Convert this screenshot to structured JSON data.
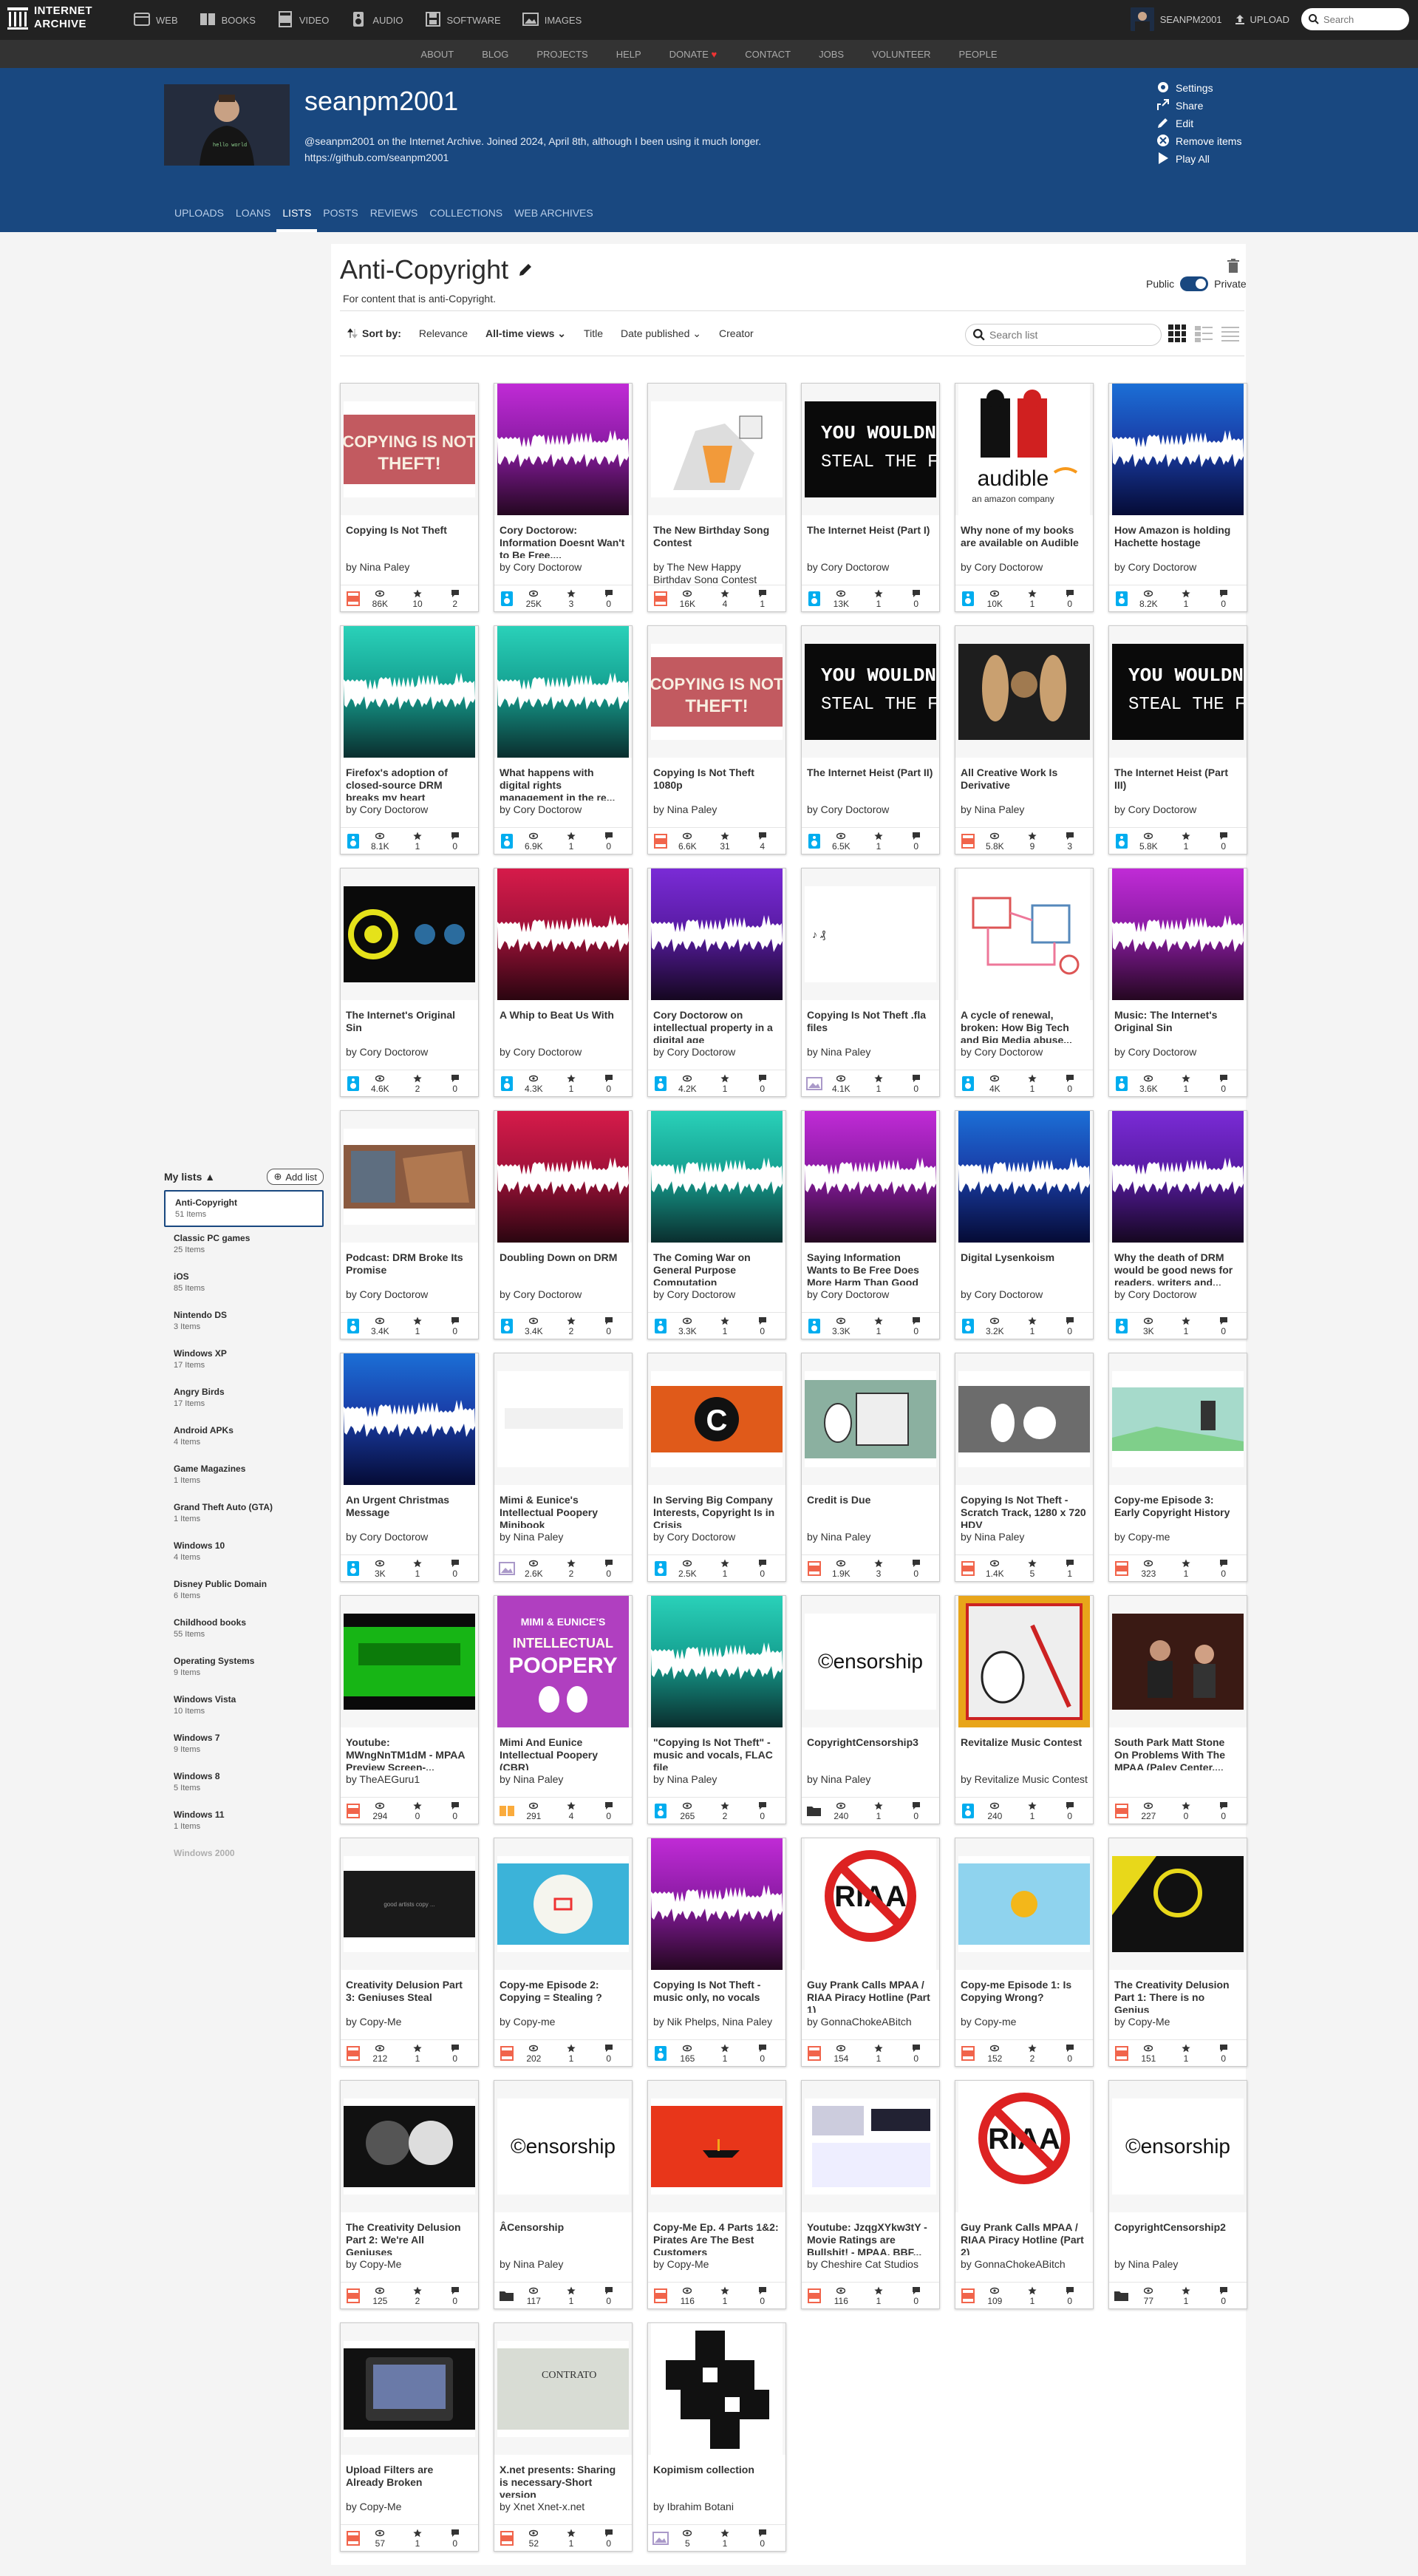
{
  "topnav": {
    "logo": "INTERNET ARCHIVE",
    "items": [
      {
        "label": "WEB",
        "icon": "web-icon"
      },
      {
        "label": "BOOKS",
        "icon": "books-icon"
      },
      {
        "label": "VIDEO",
        "icon": "video-icon"
      },
      {
        "label": "AUDIO",
        "icon": "audio-icon"
      },
      {
        "label": "SOFTWARE",
        "icon": "software-icon"
      },
      {
        "label": "IMAGES",
        "icon": "images-icon"
      }
    ],
    "user": "SEANPM2001",
    "upload": "UPLOAD",
    "search_placeholder": "Search"
  },
  "subnav": [
    "ABOUT",
    "BLOG",
    "PROJECTS",
    "HELP",
    "DONATE",
    "CONTACT",
    "JOBS",
    "VOLUNTEER",
    "PEOPLE"
  ],
  "profile": {
    "username": "seanpm2001",
    "bio_line1": "@seanpm2001 on the Internet Archive. Joined 2024, April 8th, although I been using it much longer.",
    "bio_line2": "https://github.com/seanpm2001"
  },
  "actions": [
    "Settings",
    "Share",
    "Edit",
    "Remove items",
    "Play All"
  ],
  "tabs": [
    "UPLOADS",
    "LOANS",
    "LISTS",
    "POSTS",
    "REVIEWS",
    "COLLECTIONS",
    "WEB ARCHIVES"
  ],
  "list": {
    "title": "Anti-Copyright",
    "description": "For content that is anti-Copyright.",
    "public_label": "Public",
    "private_label": "Private"
  },
  "sort": {
    "label": "Sort by:",
    "options": [
      "Relevance",
      "All-time views",
      "Title",
      "Date published",
      "Creator"
    ],
    "search_placeholder": "Search list"
  },
  "mylists": {
    "title": "My lists",
    "add": "Add list",
    "items": [
      {
        "name": "Anti-Copyright",
        "count": "51 Items"
      },
      {
        "name": "Classic PC games",
        "count": "25 Items"
      },
      {
        "name": "iOS",
        "count": "85 Items"
      },
      {
        "name": "Nintendo DS",
        "count": "3 Items"
      },
      {
        "name": "Windows XP",
        "count": "17 Items"
      },
      {
        "name": "Angry Birds",
        "count": "17 Items"
      },
      {
        "name": "Android APKs",
        "count": "4 Items"
      },
      {
        "name": "Game Magazines",
        "count": "1 Items"
      },
      {
        "name": "Grand Theft Auto (GTA)",
        "count": "1 Items"
      },
      {
        "name": "Windows 10",
        "count": "4 Items"
      },
      {
        "name": "Disney Public Domain",
        "count": "6 Items"
      },
      {
        "name": "Childhood books",
        "count": "55 Items"
      },
      {
        "name": "Operating Systems",
        "count": "9 Items"
      },
      {
        "name": "Windows Vista",
        "count": "10 Items"
      },
      {
        "name": "Windows 7",
        "count": "9 Items"
      },
      {
        "name": "Windows 8",
        "count": "5 Items"
      },
      {
        "name": "Windows 11",
        "count": "1 Items"
      },
      {
        "name": "Windows 2000",
        "count": ""
      }
    ]
  },
  "colors": {
    "accent": "#194880",
    "movies": "#f1644b",
    "audio": "#00adef",
    "texts": "#faab3c",
    "image": "#aa99c9",
    "data": "#333333"
  },
  "items": [
    {
      "title": "Copying Is Not Theft",
      "by": "by Nina Paley",
      "type": "movies",
      "views": "86K",
      "favs": "10",
      "reviews": "2",
      "thumb": "cint"
    },
    {
      "title": "Cory Doctorow: Information Doesnt Wan't to Be Free,...",
      "by": "by Cory Doctorow",
      "type": "audio",
      "views": "25K",
      "favs": "3",
      "reviews": "0",
      "thumb": "w-mag"
    },
    {
      "title": "The New Birthday Song Contest",
      "by": "by The New Happy Birthday Song Contest",
      "type": "movies",
      "views": "16K",
      "favs": "4",
      "reviews": "1",
      "thumb": "bday"
    },
    {
      "title": "The Internet Heist (Part I)",
      "by": "by Cory Doctorow",
      "type": "audio",
      "views": "13K",
      "favs": "1",
      "reviews": "0",
      "thumb": "steal"
    },
    {
      "title": "Why none of my books are available on Audible",
      "by": "by Cory Doctorow",
      "type": "audio",
      "views": "10K",
      "favs": "1",
      "reviews": "0",
      "thumb": "audible"
    },
    {
      "title": "How Amazon is holding Hachette hostage",
      "by": "by Cory Doctorow",
      "type": "audio",
      "views": "8.2K",
      "favs": "1",
      "reviews": "0",
      "thumb": "w-blue"
    },
    {
      "title": "Firefox's adoption of closed-source DRM breaks my heart",
      "by": "by Cory Doctorow",
      "type": "audio",
      "views": "8.1K",
      "favs": "1",
      "reviews": "0",
      "thumb": "w-teal"
    },
    {
      "title": "What happens with digital rights management in the re...",
      "by": "by Cory Doctorow",
      "type": "audio",
      "views": "6.9K",
      "favs": "1",
      "reviews": "0",
      "thumb": "w-teal"
    },
    {
      "title": "Copying Is Not Theft 1080p",
      "by": "by Nina Paley",
      "type": "movies",
      "views": "6.6K",
      "favs": "31",
      "reviews": "4",
      "thumb": "cint"
    },
    {
      "title": "The Internet Heist (Part II)",
      "by": "by Cory Doctorow",
      "type": "audio",
      "views": "6.5K",
      "favs": "1",
      "reviews": "0",
      "thumb": "steal"
    },
    {
      "title": "All Creative Work Is Derivative",
      "by": "by Nina Paley",
      "type": "movies",
      "views": "5.8K",
      "favs": "9",
      "reviews": "3",
      "thumb": "deriv"
    },
    {
      "title": "The Internet Heist (Part III)",
      "by": "by Cory Doctorow",
      "type": "audio",
      "views": "5.8K",
      "favs": "1",
      "reviews": "0",
      "thumb": "steal"
    },
    {
      "title": "The Internet's Original Sin",
      "by": "by Cory Doctorow",
      "type": "audio",
      "views": "4.6K",
      "favs": "2",
      "reviews": "0",
      "thumb": "sin"
    },
    {
      "title": "A Whip to Beat Us With",
      "by": "by Cory Doctorow",
      "type": "audio",
      "views": "4.3K",
      "favs": "1",
      "reviews": "0",
      "thumb": "w-red"
    },
    {
      "title": "Cory Doctorow on intellectual property in a digital age",
      "by": "by Cory Doctorow",
      "type": "audio",
      "views": "4.2K",
      "favs": "1",
      "reviews": "0",
      "thumb": "w-purple"
    },
    {
      "title": "Copying Is Not Theft .fla files",
      "by": "by Nina Paley",
      "type": "image",
      "views": "4.1K",
      "favs": "1",
      "reviews": "0",
      "thumb": "blank"
    },
    {
      "title": "A cycle of renewal, broken: How Big Tech and Big Media abuse...",
      "by": "by Cory Doctorow",
      "type": "audio",
      "views": "4K",
      "favs": "1",
      "reviews": "0",
      "thumb": "cycle"
    },
    {
      "title": "Music: The Internet's Original Sin",
      "by": "by Cory Doctorow",
      "type": "audio",
      "views": "3.6K",
      "favs": "1",
      "reviews": "0",
      "thumb": "w-mag"
    },
    {
      "title": "Podcast: DRM Broke Its Promise",
      "by": "by Cory Doctorow",
      "type": "audio",
      "views": "3.4K",
      "favs": "1",
      "reviews": "0",
      "thumb": "podcast"
    },
    {
      "title": "Doubling Down on DRM",
      "by": "by Cory Doctorow",
      "type": "audio",
      "views": "3.4K",
      "favs": "2",
      "reviews": "0",
      "thumb": "w-red"
    },
    {
      "title": "The Coming War on General Purpose Computation",
      "by": "by Cory Doctorow",
      "type": "audio",
      "views": "3.3K",
      "favs": "1",
      "reviews": "0",
      "thumb": "w-teal"
    },
    {
      "title": "Saying Information Wants to Be Free Does More Harm Than Good",
      "by": "by Cory Doctorow",
      "type": "audio",
      "views": "3.3K",
      "favs": "1",
      "reviews": "0",
      "thumb": "w-mag"
    },
    {
      "title": "Digital Lysenkoism",
      "by": "by Cory Doctorow",
      "type": "audio",
      "views": "3.2K",
      "favs": "1",
      "reviews": "0",
      "thumb": "w-blue"
    },
    {
      "title": "Why the death of DRM would be good news for readers, writers and...",
      "by": "by Cory Doctorow",
      "type": "audio",
      "views": "3K",
      "favs": "1",
      "reviews": "0",
      "thumb": "w-purple"
    },
    {
      "title": "An Urgent Christmas Message",
      "by": "by Cory Doctorow",
      "type": "audio",
      "views": "3K",
      "favs": "1",
      "reviews": "0",
      "thumb": "w-blue"
    },
    {
      "title": "Mimi & Eunice's Intellectual Poopery Minibook",
      "by": "by Nina Paley",
      "type": "image",
      "views": "2.6K",
      "favs": "2",
      "reviews": "0",
      "thumb": "whiteband"
    },
    {
      "title": "In Serving Big Company Interests, Copyright Is in Crisis",
      "by": "by Cory Doctorow",
      "type": "audio",
      "views": "2.5K",
      "favs": "1",
      "reviews": "0",
      "thumb": "crisis"
    },
    {
      "title": "Credit is Due",
      "by": "by Nina Paley",
      "type": "movies",
      "views": "1.9K",
      "favs": "3",
      "reviews": "0",
      "thumb": "credit"
    },
    {
      "title": "Copying Is Not Theft - Scratch Track, 1280 x 720 HDV",
      "by": "by Nina Paley",
      "type": "movies",
      "views": "1.4K",
      "favs": "5",
      "reviews": "1",
      "thumb": "scratch"
    },
    {
      "title": "Copy-me Episode 3: Early Copyright History",
      "by": "by Copy-me",
      "type": "movies",
      "views": "323",
      "favs": "1",
      "reviews": "0",
      "thumb": "castle"
    },
    {
      "title": "Youtube: MWngNnTM1dM - MPAA Preview Screen-...",
      "by": "by TheAEGuru1",
      "type": "movies",
      "views": "294",
      "favs": "0",
      "reviews": "0",
      "thumb": "green"
    },
    {
      "title": "Mimi And Eunice Intellectual Poopery (CBR)",
      "by": "by Nina Paley",
      "type": "texts",
      "views": "291",
      "favs": "4",
      "reviews": "0",
      "thumb": "poopery"
    },
    {
      "title": "\"Copying Is Not Theft\" - music and vocals, FLAC file",
      "by": "by Nina Paley",
      "type": "audio",
      "views": "265",
      "favs": "2",
      "reviews": "0",
      "thumb": "w-teal"
    },
    {
      "title": "CopyrightCensorship3",
      "by": "by Nina Paley",
      "type": "data",
      "views": "240",
      "favs": "1",
      "reviews": "0",
      "thumb": "censor"
    },
    {
      "title": "Revitalize Music Contest",
      "by": "by Revitalize Music Contest",
      "type": "audio",
      "views": "240",
      "favs": "1",
      "reviews": "0",
      "thumb": "revital"
    },
    {
      "title": "South Park Matt Stone On Problems With The MPAA (Paley Center,...",
      "by": "",
      "type": "movies",
      "views": "227",
      "favs": "0",
      "reviews": "0",
      "thumb": "southpark"
    },
    {
      "title": "Creativity Delusion Part 3: Geniuses Steal",
      "by": "by Copy-Me",
      "type": "movies",
      "views": "212",
      "favs": "1",
      "reviews": "0",
      "thumb": "dark"
    },
    {
      "title": "Copy-me Episode 2: Copying = Stealing ?",
      "by": "by Copy-me",
      "type": "movies",
      "views": "202",
      "favs": "1",
      "reviews": "0",
      "thumb": "ep2"
    },
    {
      "title": "Copying Is Not Theft - music only, no vocals",
      "by": "by Nik Phelps, Nina Paley",
      "type": "audio",
      "views": "165",
      "favs": "1",
      "reviews": "0",
      "thumb": "w-mag"
    },
    {
      "title": "Guy Prank Calls MPAA / RIAA Piracy Hotline (Part 1)",
      "by": "by GonnaChokeABitch",
      "type": "movies",
      "views": "154",
      "favs": "1",
      "reviews": "0",
      "thumb": "riaa"
    },
    {
      "title": "Copy-me Episode 1: Is Copying Wrong?",
      "by": "by Copy-me",
      "type": "movies",
      "views": "152",
      "favs": "2",
      "reviews": "0",
      "thumb": "sun"
    },
    {
      "title": "The Creativity Delusion Part 1: There is no Genius",
      "by": "by Copy-Me",
      "type": "movies",
      "views": "151",
      "favs": "1",
      "reviews": "0",
      "thumb": "yellowdark"
    },
    {
      "title": "The Creativity Delusion Part 2: We're All Geniuses",
      "by": "by Copy-Me",
      "type": "movies",
      "views": "125",
      "favs": "2",
      "reviews": "0",
      "thumb": "portraits"
    },
    {
      "title": "ÂCensorship",
      "by": "by Nina Paley",
      "type": "data",
      "views": "117",
      "favs": "1",
      "reviews": "0",
      "thumb": "censor"
    },
    {
      "title": "Copy-Me Ep. 4 Parts 1&2: Pirates Are The Best Customers",
      "by": "by Copy-Me",
      "type": "movies",
      "views": "116",
      "favs": "1",
      "reviews": "0",
      "thumb": "redship"
    },
    {
      "title": "Youtube: JzqgXYkw3tY - Movie Ratings are Bullshit! - MPAA, BBF...",
      "by": "by Cheshire Cat Studios",
      "type": "movies",
      "views": "116",
      "favs": "1",
      "reviews": "0",
      "thumb": "ratings"
    },
    {
      "title": "Guy Prank Calls MPAA / RIAA Piracy Hotline (Part 2)",
      "by": "by GonnaChokeABitch",
      "type": "movies",
      "views": "109",
      "favs": "1",
      "reviews": "0",
      "thumb": "riaa"
    },
    {
      "title": "CopyrightCensorship2",
      "by": "by Nina Paley",
      "type": "data",
      "views": "77",
      "favs": "1",
      "reviews": "0",
      "thumb": "censor"
    },
    {
      "title": "Upload Filters are Already Broken",
      "by": "by Copy-Me",
      "type": "movies",
      "views": "57",
      "favs": "1",
      "reviews": "0",
      "thumb": "tv"
    },
    {
      "title": "X.net presents: Sharing is necessary-Short version",
      "by": "by Xnet Xnet-x.net",
      "type": "movies",
      "views": "52",
      "favs": "1",
      "reviews": "0",
      "thumb": "xnet"
    },
    {
      "title": "Kopimism collection",
      "by": "by Ibrahim Botani",
      "type": "image",
      "views": "5",
      "favs": "1",
      "reviews": "0",
      "thumb": "kopimi"
    }
  ]
}
